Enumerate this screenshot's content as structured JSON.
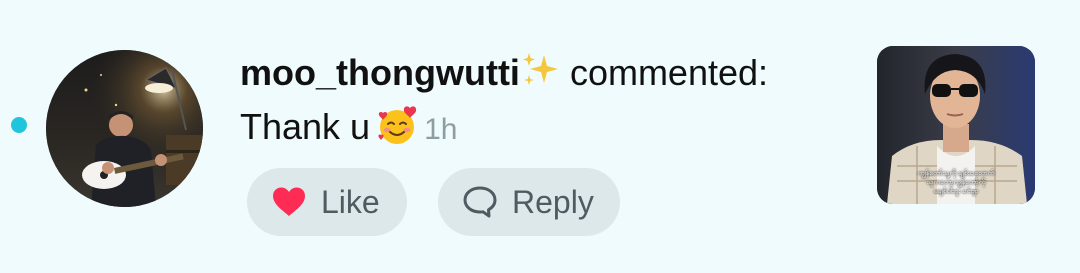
{
  "notification": {
    "username": "moo_thongwutti",
    "action": "commented:",
    "comment": "Thank u",
    "time": "1h"
  },
  "buttons": {
    "like_label": "Like",
    "reply_label": "Reply"
  },
  "thumbnail": {
    "subtitle_line1": "ကျွန်တော်သူ့ကို ချစ်သလောက်",
    "subtitle_line2": "သူကတော့ကျွန်တော့်ကို",
    "subtitle_line3": "မချစ်ပါဘူး ခင်ဗျာ"
  },
  "icons": {
    "sparkle": "sparkles-icon",
    "emoji": "smiling-face-with-hearts-icon",
    "like": "heart-icon",
    "reply": "speech-bubble-icon"
  },
  "colors": {
    "background": "#effbfc",
    "unread_dot": "#20c5dd",
    "heart": "#fe2c55",
    "button_bg": "#dde8eb",
    "time_text": "#8d9ea3"
  }
}
